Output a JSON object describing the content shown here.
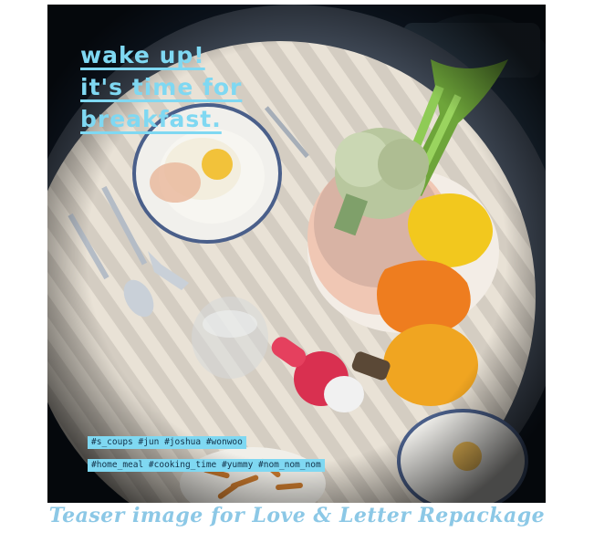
{
  "headline": [
    "wake up!",
    "it's time for",
    "breakfast."
  ],
  "hashtags": [
    "#s_coups #jun #joshua #wonwoo",
    "#home_meal #cooking_time #yummy #nom_nom_nom"
  ],
  "caption": "Teaser image for Love & Letter Repackage",
  "colors": {
    "accent": "#7fd8f2",
    "caption": "#8cc8e6"
  }
}
